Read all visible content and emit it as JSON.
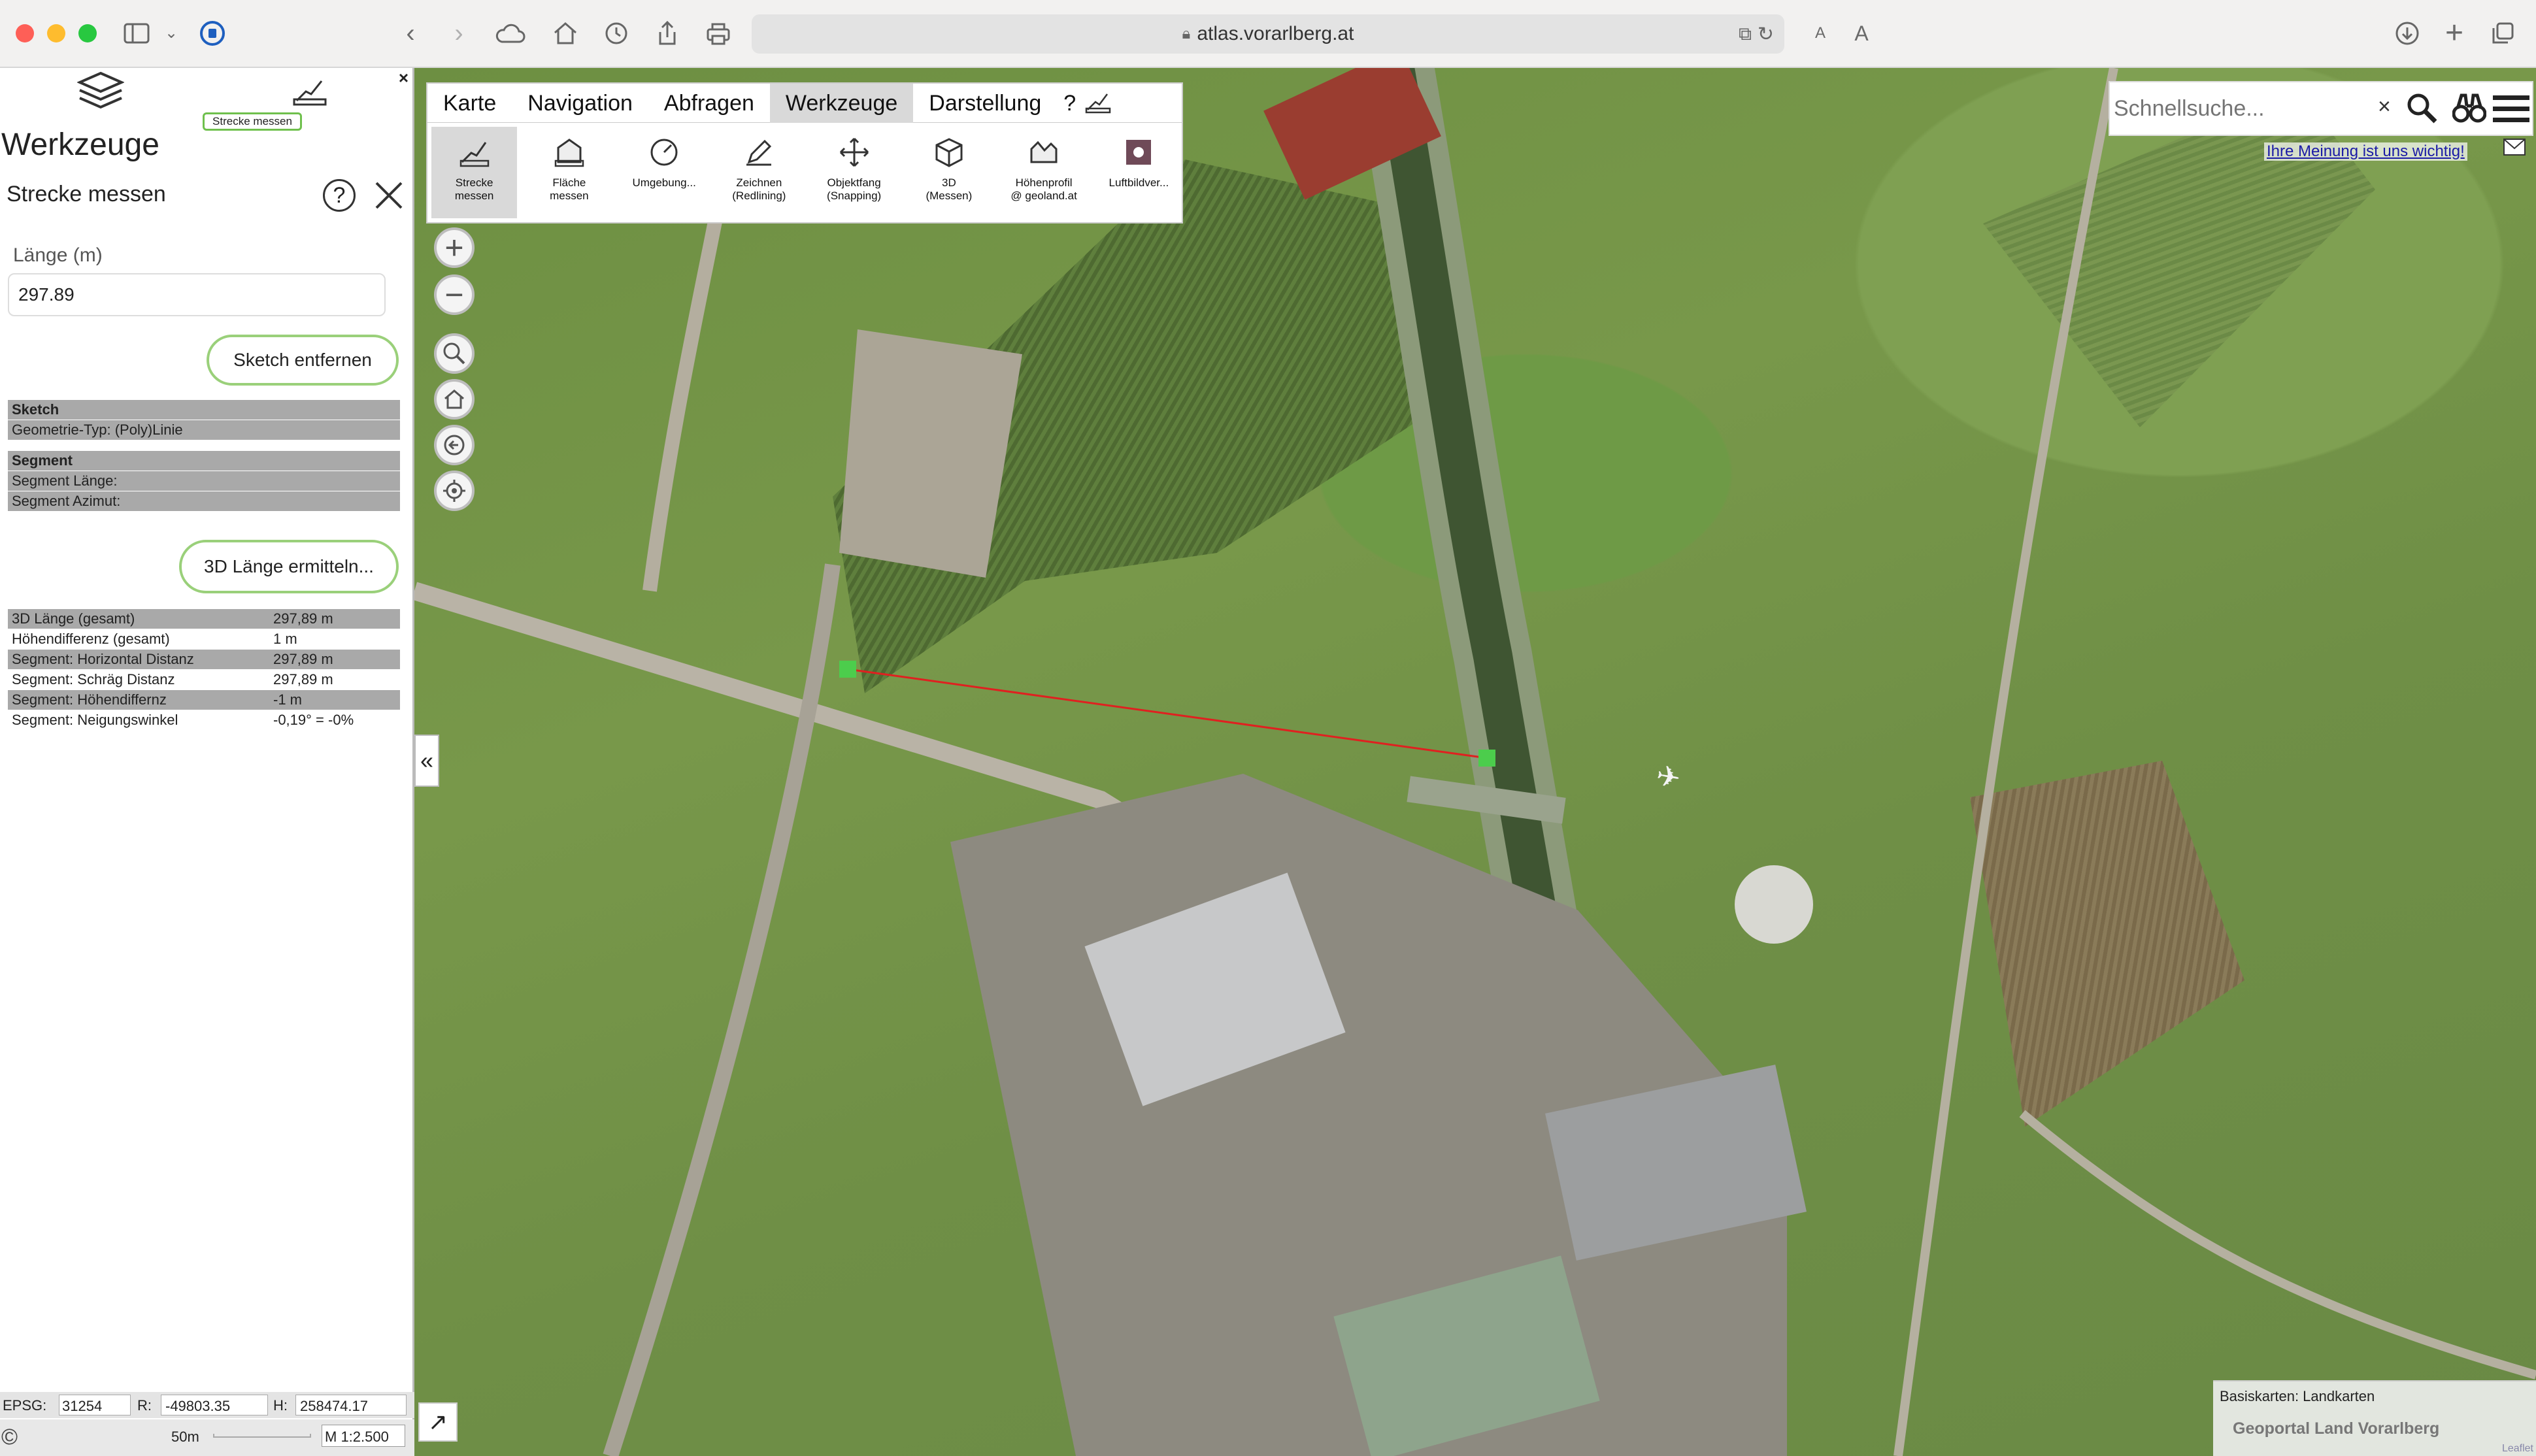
{
  "browser": {
    "url": "atlas.vorarlberg.at",
    "text_size_small": "A",
    "text_size_large": "A"
  },
  "panel": {
    "close_x": "×",
    "layer_icon": "layers-icon",
    "measure_badge": "Strecke messen",
    "title": "Werkzeuge",
    "subtitle": "Strecke messen",
    "help": "?",
    "length_label": "Länge (m)",
    "length_value": "297.89",
    "sketch_remove": "Sketch entfernen",
    "sketch_header": "Sketch",
    "geom_type": "Geometrie-Typ: (Poly)Linie",
    "segment_header": "Segment",
    "segment_length": "Segment Länge:",
    "segment_azimuth": "Segment Azimut:",
    "btn_3d": "3D Länge ermitteln...",
    "results": [
      {
        "k": "3D Länge (gesamt)",
        "v": "297,89 m"
      },
      {
        "k": "Höhendifferenz (gesamt)",
        "v": "1 m"
      },
      {
        "k": "Segment: Horizontal Distanz",
        "v": "297,89 m"
      },
      {
        "k": "Segment: Schräg Distanz",
        "v": "297,89 m"
      },
      {
        "k": "Segment: Höhendiffernz",
        "v": "-1 m"
      },
      {
        "k": "Segment: Neigungswinkel",
        "v": "-0,19° = -0%"
      }
    ],
    "footer": {
      "epsg_label": "EPSG:",
      "epsg": "31254",
      "r_label": "R:",
      "r": "-49803.35",
      "h_label": "H:",
      "h": "258474.17",
      "scale_bar": "50m",
      "scale": "M 1:2.500"
    }
  },
  "toolbar": {
    "tabs": [
      "Karte",
      "Navigation",
      "Abfragen",
      "Werkzeuge",
      "Darstellung",
      "?"
    ],
    "active_tab": "Werkzeuge",
    "tools": [
      {
        "l1": "Strecke",
        "l2": "messen"
      },
      {
        "l1": "Fläche",
        "l2": "messen"
      },
      {
        "l1": "Umgebung...",
        "l2": ""
      },
      {
        "l1": "Zeichnen",
        "l2": "(Redlining)"
      },
      {
        "l1": "Objektfang",
        "l2": "(Snapping)"
      },
      {
        "l1": "3D",
        "l2": "(Messen)"
      },
      {
        "l1": "Höhenprofil",
        "l2": "@ geoland.at"
      },
      {
        "l1": "Luftbildver...",
        "l2": ""
      }
    ]
  },
  "map": {
    "search_placeholder": "Schnellsuche...",
    "search_clear": "×",
    "feedback_link": "Ihre Meinung ist uns wichtig!",
    "collapse": "«",
    "basemap_label": "Basiskarten: Landkarten",
    "basemap_name": "Geoportal Land Vorarlberg",
    "leaflet": "Leaflet",
    "measure_color": "#e02020",
    "vertex_color": "#4ccd4c"
  }
}
